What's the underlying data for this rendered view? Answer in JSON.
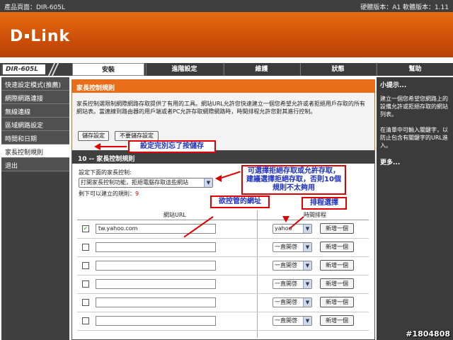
{
  "topbar": {
    "product": "產品頁面：DIR-605L",
    "version": "硬體版本：A1   軟體版本：1.11"
  },
  "logo": {
    "left": "D",
    "right": "Link"
  },
  "model": "DIR-605L",
  "tabs": [
    {
      "label": "安裝"
    },
    {
      "label": "進階設定"
    },
    {
      "label": "維護"
    },
    {
      "label": "狀態"
    },
    {
      "label": "幫助"
    }
  ],
  "sidebar": {
    "items": [
      {
        "label": "快速設定模式(推薦)"
      },
      {
        "label": "網際網路連接"
      },
      {
        "label": "無線連線"
      },
      {
        "label": "區域網路設定"
      },
      {
        "label": "時間和日期"
      },
      {
        "label": "家長控制規則"
      },
      {
        "label": "退出"
      }
    ]
  },
  "info": {
    "title": "家長控制規則",
    "text": "家長控制選限制網際網路存取提供了有用的工具。網站URL允許您快速建立一個您希望允許或者拒絕用戶存取的所有網站表。當連線到路由器的用戶端或者PC允許存取網際網路時，時間排程允許您對其進行控制。",
    "save": "儲存設定",
    "nosave": "不要儲存設定"
  },
  "section": {
    "title": "10 -- 家長控制規則",
    "config_label": "設定下面的家長控制:",
    "mode": "打開家長控制功能，拒絕電腦存取這些網站",
    "remaining_label": "剩下可以建立的規則：",
    "remaining": "9",
    "col_url": "網站URL",
    "col_schedule": "時間排程"
  },
  "rows": [
    {
      "checked": "✓",
      "url": "tw.yahoo.com",
      "schedule": "yahoo",
      "add": "新增一個"
    },
    {
      "checked": "",
      "url": "",
      "schedule": "一直開啓",
      "add": "新增一個"
    },
    {
      "checked": "",
      "url": "",
      "schedule": "一直開啓",
      "add": "新增一個"
    },
    {
      "checked": "",
      "url": "",
      "schedule": "一直開啓",
      "add": "新增一個"
    },
    {
      "checked": "",
      "url": "",
      "schedule": "一直開啓",
      "add": "新增一個"
    },
    {
      "checked": "",
      "url": "",
      "schedule": "一直開啓",
      "add": "新增一個"
    }
  ],
  "right": {
    "title": "小提示...",
    "p1": "建立一個您希望您網路上的設備允許或拒絕存取的網站列表。",
    "p2": "在清單中可輸入關鍵字，以防止包含有關鍵字的URL進入。",
    "more": "更多..."
  },
  "annotations": {
    "save_note": "設定完別忘了按儲存",
    "mode_note": "可選擇拒絕存取或允許存取，建議選擇拒絕存取，否則10個規則不太夠用",
    "url_note": "欲控管的網址",
    "sched_note": "排程選擇"
  },
  "watermark": "#1804808"
}
